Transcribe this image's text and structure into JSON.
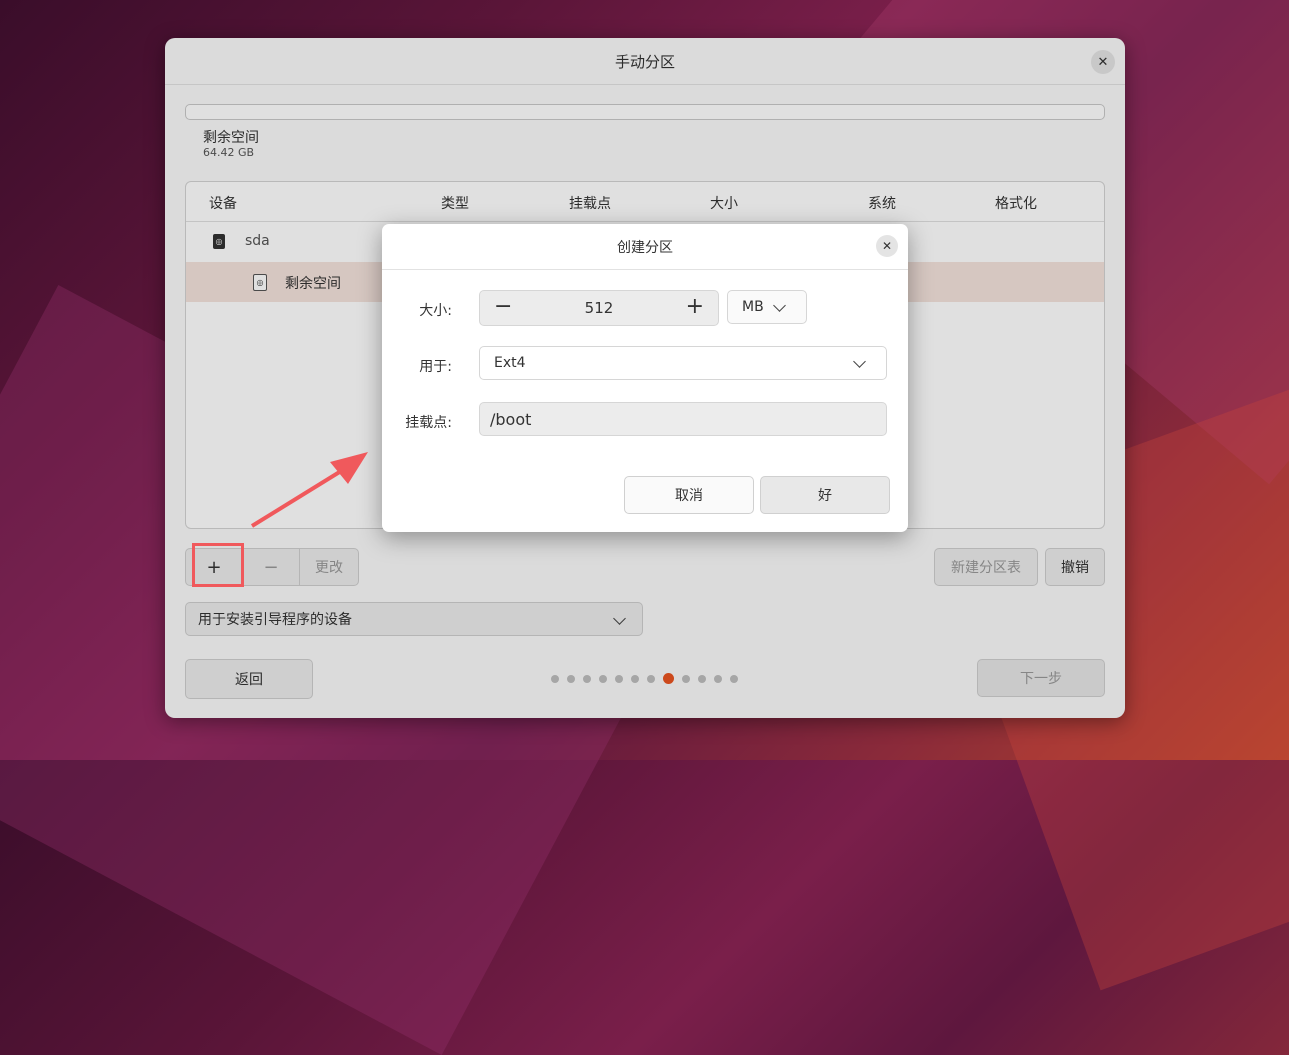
{
  "window": {
    "title": "手动分区",
    "close_icon": "close-icon",
    "free_space_label": "剩余空间",
    "free_space_size": "64.42 GB",
    "table": {
      "headers": [
        "设备",
        "类型",
        "挂载点",
        "大小",
        "系统",
        "格式化"
      ],
      "rows": [
        {
          "device": "sda",
          "icon": "disk-icon"
        },
        {
          "device": "剩余空间",
          "icon": "disk-icon"
        }
      ]
    },
    "buttons": {
      "add": "+",
      "remove": "−",
      "change": "更改",
      "new_table": "新建分区表",
      "revert": "撤销",
      "back": "返回",
      "next": "下一步"
    },
    "bootloader_device_label": "用于安装引导程序的设备",
    "page_dots": {
      "total": 12,
      "active_index": 7
    }
  },
  "dialog": {
    "title": "创建分区",
    "size_label": "大小:",
    "size_value": "512",
    "size_unit": "MB",
    "use_label": "用于:",
    "use_value": "Ext4",
    "mount_label": "挂载点:",
    "mount_value": "/boot",
    "cancel": "取消",
    "ok": "好"
  },
  "colors": {
    "accent": "#e95420",
    "annotation": "#f0595c",
    "selected_row": "#f4e3dc"
  }
}
